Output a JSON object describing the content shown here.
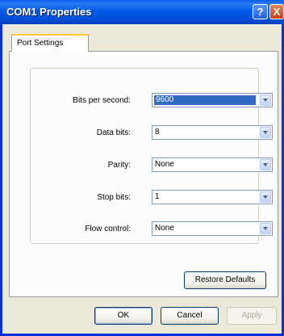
{
  "window": {
    "title": "COM1 Properties",
    "help_glyph": "?",
    "close_glyph": "X"
  },
  "tabs": [
    {
      "label": "Port Settings",
      "active": true
    }
  ],
  "settings": {
    "bits_per_second": {
      "label": "Bits per second:",
      "value": "9600",
      "selected": true
    },
    "data_bits": {
      "label": "Data bits:",
      "value": "8"
    },
    "parity": {
      "label": "Parity:",
      "value": "None"
    },
    "stop_bits": {
      "label": "Stop bits:",
      "value": "1"
    },
    "flow_control": {
      "label": "Flow control:",
      "value": "None"
    }
  },
  "buttons": {
    "restore_defaults": "Restore Defaults",
    "ok": "OK",
    "cancel": "Cancel",
    "apply": "Apply"
  },
  "colors": {
    "titlebar": "#0058e6",
    "selection": "#316ac5",
    "tab_highlight": "#ffc83c"
  }
}
